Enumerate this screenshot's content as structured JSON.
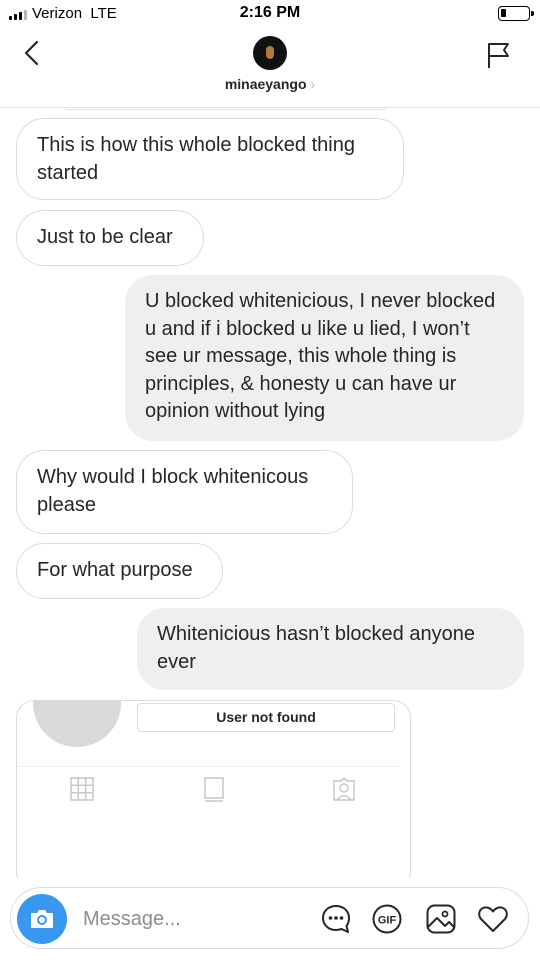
{
  "status_bar": {
    "carrier": "Verizon",
    "network": "LTE",
    "time": "2:16 PM",
    "battery_level": 0.2
  },
  "header": {
    "username": "minaeyango",
    "chevron": "›",
    "icons": [
      "back-chevron-icon",
      "avatar",
      "flag-icon"
    ]
  },
  "messages": [
    {
      "side": "received",
      "text": "This is how this whole blocked thing started"
    },
    {
      "side": "received",
      "text": "Just to be clear"
    },
    {
      "side": "sent",
      "text": "U blocked whitenicious, I never blocked u and if i blocked u like u lied, I won’t see ur message, this whole thing is principles, & honesty u can have ur opinion without lying"
    },
    {
      "side": "received",
      "text": "Why would I block whitenicous please"
    },
    {
      "side": "received",
      "text": "For what purpose"
    },
    {
      "side": "sent",
      "text": "Whitenicious hasn’t blocked anyone ever"
    }
  ],
  "profile_card": {
    "status_label": "User not found",
    "tabs": [
      "grid-icon",
      "igtv-icon",
      "tagged-icon"
    ]
  },
  "composer": {
    "placeholder": "Message...",
    "icons": [
      "camera-icon",
      "more-icon",
      "gif-icon",
      "photo-icon",
      "heart-icon"
    ],
    "gif_label": "GIF"
  },
  "colors": {
    "accent": "#3897f0",
    "sent_bubble": "#efefef",
    "border": "#dbdbdb",
    "text": "#262626"
  }
}
